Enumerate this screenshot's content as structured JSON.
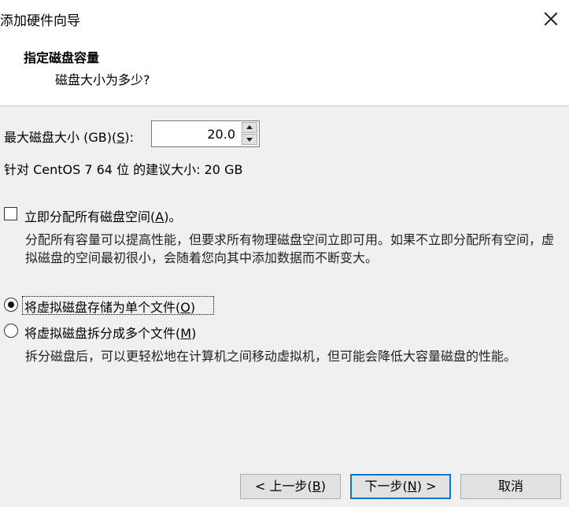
{
  "window": {
    "title": "添加硬件向导"
  },
  "header": {
    "title": "指定磁盘容量",
    "subtitle": "磁盘大小为多少?"
  },
  "disk_size": {
    "label_prefix": "最大磁盘大小 (GB)(",
    "label_key": "S",
    "label_suffix": "):",
    "value": "20.0"
  },
  "recommended": {
    "text": "针对 CentOS 7 64 位 的建议大小: 20 GB"
  },
  "allocate": {
    "label_prefix": "立即分配所有磁盘空间(",
    "label_key": "A",
    "label_suffix": ")。",
    "checked": false,
    "description": "分配所有容量可以提高性能，但要求所有物理磁盘空间立即可用。如果不立即分配所有空间，虚拟磁盘的空间最初很小，会随着您向其中添加数据而不断变大。"
  },
  "storage_options": [
    {
      "label_prefix": "将虚拟磁盘存储为单个文件(",
      "label_key": "O",
      "label_suffix": ")",
      "selected": true
    },
    {
      "label_prefix": "将虚拟磁盘拆分成多个文件(",
      "label_key": "M",
      "label_suffix": ")",
      "selected": false,
      "description": "拆分磁盘后，可以更轻松地在计算机之间移动虚拟机，但可能会降低大容量磁盘的性能。"
    }
  ],
  "buttons": {
    "back": {
      "prefix": "< 上一步(",
      "key": "B",
      "suffix": ")"
    },
    "next": {
      "prefix": "下一步(",
      "key": "N",
      "suffix": ") >"
    },
    "cancel": "取消"
  },
  "colors": {
    "accent": "#0078d7",
    "window_bg": "#f0f0f0",
    "header_bg": "#ffffff"
  }
}
